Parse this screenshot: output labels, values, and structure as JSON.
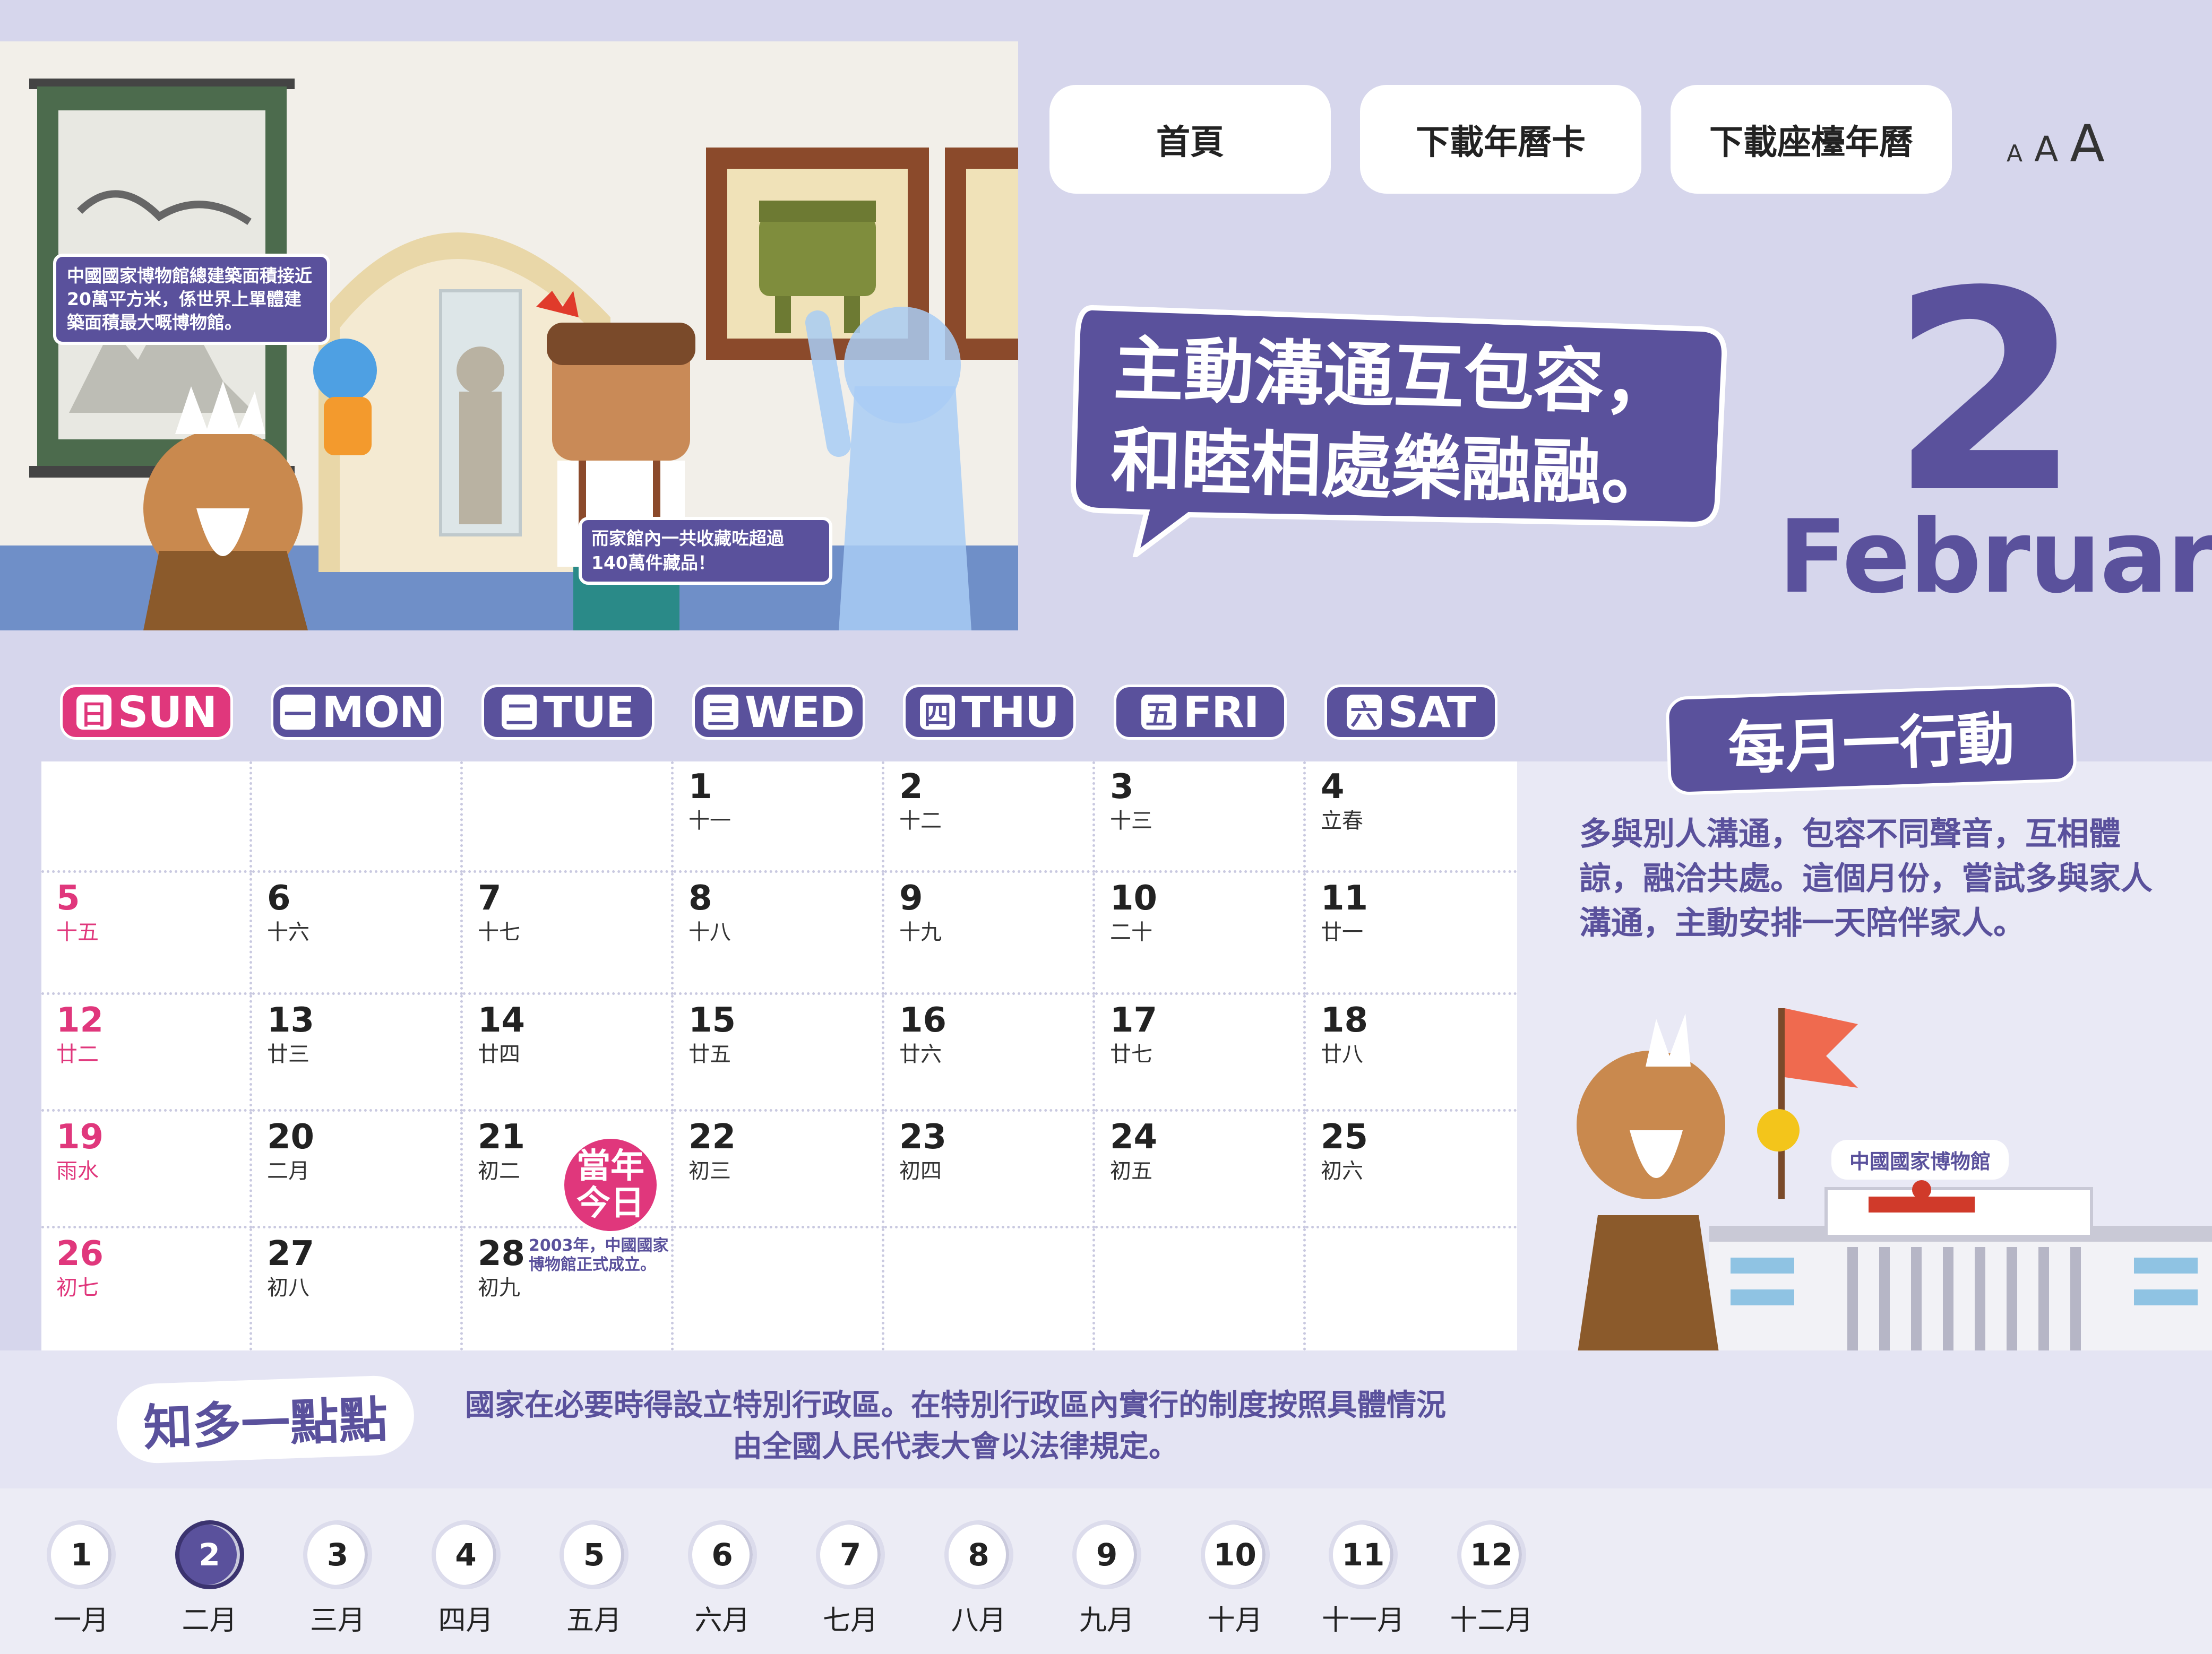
{
  "nav": {
    "home": "首頁",
    "download_card": "下載年曆卡",
    "download_desk": "下載座檯年曆",
    "font_sizes": [
      "A",
      "A",
      "A"
    ]
  },
  "illustration": {
    "note_museum": "中國國家博物館總建築面積接近20萬平方米，係世界上單體建築面積最大嘅博物館。",
    "note_collection": "而家館內一共收藏咗超過140萬件藏品！"
  },
  "slogan": {
    "line1": "主動溝通互包容，",
    "line2": "和睦相處樂融融。"
  },
  "month": {
    "number": "2",
    "name": "February"
  },
  "weekdays": [
    {
      "zh": "日",
      "en": "SUN"
    },
    {
      "zh": "一",
      "en": "MON"
    },
    {
      "zh": "二",
      "en": "TUE"
    },
    {
      "zh": "三",
      "en": "WED"
    },
    {
      "zh": "四",
      "en": "THU"
    },
    {
      "zh": "五",
      "en": "FRI"
    },
    {
      "zh": "六",
      "en": "SAT"
    }
  ],
  "calendar": {
    "rows": [
      [
        null,
        null,
        null,
        {
          "day": "1",
          "lunar": "十一"
        },
        {
          "day": "2",
          "lunar": "十二"
        },
        {
          "day": "3",
          "lunar": "十三"
        },
        {
          "day": "4",
          "lunar": "立春"
        }
      ],
      [
        {
          "day": "5",
          "lunar": "十五"
        },
        {
          "day": "6",
          "lunar": "十六"
        },
        {
          "day": "7",
          "lunar": "十七"
        },
        {
          "day": "8",
          "lunar": "十八"
        },
        {
          "day": "9",
          "lunar": "十九"
        },
        {
          "day": "10",
          "lunar": "二十"
        },
        {
          "day": "11",
          "lunar": "廿一"
        }
      ],
      [
        {
          "day": "12",
          "lunar": "廿二"
        },
        {
          "day": "13",
          "lunar": "廿三"
        },
        {
          "day": "14",
          "lunar": "廿四"
        },
        {
          "day": "15",
          "lunar": "廿五"
        },
        {
          "day": "16",
          "lunar": "廿六"
        },
        {
          "day": "17",
          "lunar": "廿七"
        },
        {
          "day": "18",
          "lunar": "廿八"
        }
      ],
      [
        {
          "day": "19",
          "lunar": "雨水"
        },
        {
          "day": "20",
          "lunar": "二月"
        },
        {
          "day": "21",
          "lunar": "初二"
        },
        {
          "day": "22",
          "lunar": "初三"
        },
        {
          "day": "23",
          "lunar": "初四"
        },
        {
          "day": "24",
          "lunar": "初五"
        },
        {
          "day": "25",
          "lunar": "初六"
        }
      ],
      [
        {
          "day": "26",
          "lunar": "初七"
        },
        {
          "day": "27",
          "lunar": "初八"
        },
        {
          "day": "28",
          "lunar": "初九"
        },
        null,
        null,
        null,
        null
      ]
    ],
    "today_badge_line1": "當年",
    "today_badge_line2": "今日",
    "today_note": "2003年，中國國家博物館正式成立。"
  },
  "monthly_action": {
    "title": "每月一行動",
    "text": "多與別人溝通，包容不同聲音，互相體諒，融洽共處。這個月份，嘗試多與家人溝通，主動安排一天陪伴家人。",
    "museum_label": "中國國家博物館"
  },
  "know_more": {
    "title": "知多一點點",
    "line1": "國家在必要時得設立特別行政區。在特別行政區內實行的制度按照具體情況",
    "line2": "由全國人民代表大會以法律規定。"
  },
  "month_nav": [
    {
      "num": "1",
      "label": "一月"
    },
    {
      "num": "2",
      "label": "二月"
    },
    {
      "num": "3",
      "label": "三月"
    },
    {
      "num": "4",
      "label": "四月"
    },
    {
      "num": "5",
      "label": "五月"
    },
    {
      "num": "6",
      "label": "六月"
    },
    {
      "num": "7",
      "label": "七月"
    },
    {
      "num": "8",
      "label": "八月"
    },
    {
      "num": "9",
      "label": "九月"
    },
    {
      "num": "10",
      "label": "十月"
    },
    {
      "num": "11",
      "label": "十一月"
    },
    {
      "num": "12",
      "label": "十二月"
    }
  ],
  "active_month": 2,
  "colors": {
    "background": "#d6d6ec",
    "primary_purple": "#5a519c",
    "sunday_pink": "#e0377c",
    "flag_red": "#ef6a4f"
  }
}
